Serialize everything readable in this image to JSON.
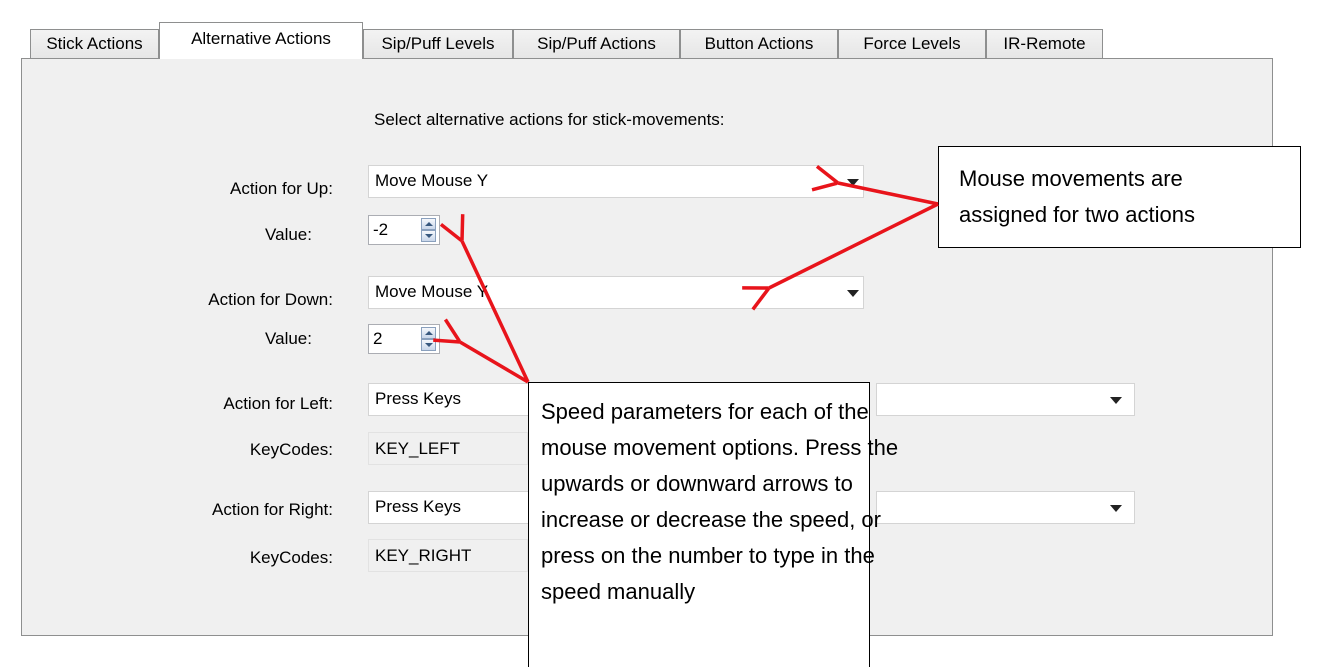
{
  "tabs": [
    {
      "label": "Stick Actions"
    },
    {
      "label": "Alternative Actions"
    },
    {
      "label": "Sip/Puff Levels"
    },
    {
      "label": "Sip/Puff Actions"
    },
    {
      "label": "Button Actions"
    },
    {
      "label": "Force Levels"
    },
    {
      "label": "IR-Remote"
    }
  ],
  "active_tab": "Alternative Actions",
  "panel": {
    "heading": "Select alternative actions for stick-movements:",
    "up": {
      "label": "Action for Up:",
      "action": "Move Mouse Y",
      "value_label": "Value:",
      "value": "-2"
    },
    "down": {
      "label": "Action for Down:",
      "action": "Move Mouse Y",
      "value_label": "Value:",
      "value": "2"
    },
    "left": {
      "label": "Action for Left:",
      "action": "Press Keys",
      "keycodes_label": "KeyCodes:",
      "keycodes": "KEY_LEFT"
    },
    "right": {
      "label": "Action for Right:",
      "action": "Press Keys",
      "keycodes_label": "KeyCodes:",
      "keycodes": "KEY_RIGHT"
    }
  },
  "callouts": {
    "mouse": [
      "Mouse movements are",
      "assigned for two actions"
    ],
    "speed": [
      "Speed parameters for each of the",
      "mouse movement options. Press the",
      "upwards or downward arrows to",
      "increase or decrease the speed, or",
      "press on the number to type in the",
      "speed manually"
    ]
  },
  "colors": {
    "annotation_arrow": "#e8141b",
    "panel_bg": "#f0f0f0"
  },
  "icons": {
    "combo_dropdown": "chevron-down-icon",
    "spinner": "spin-up-down-icon"
  }
}
